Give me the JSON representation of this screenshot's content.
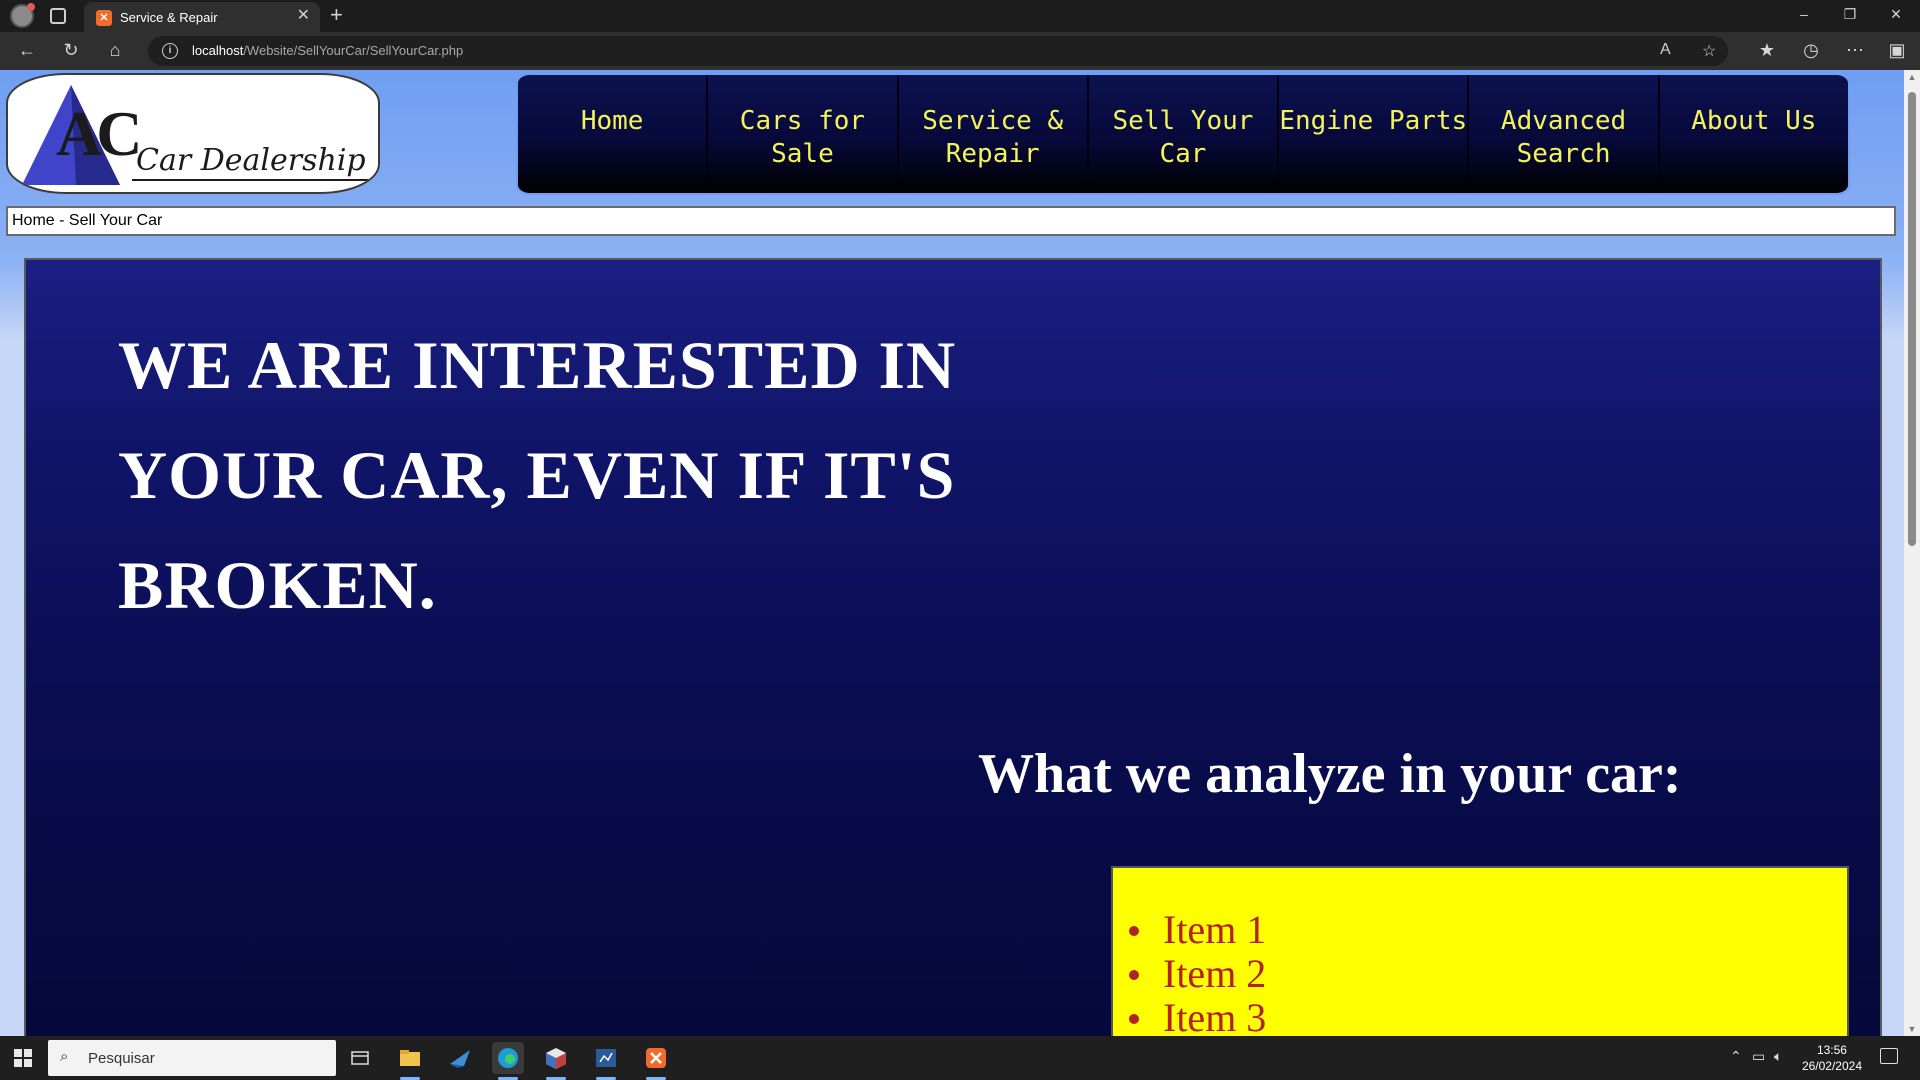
{
  "browser": {
    "tab_title": "Service & Repair",
    "tab_favicon": "xampp-icon",
    "url_host": "localhost",
    "url_path": "/Website/SellYourCar/SellYourCar.php"
  },
  "logo": {
    "mark": "AC",
    "name": "Car Dealership"
  },
  "menu": {
    "items": [
      {
        "label": "Home"
      },
      {
        "label": "Cars for Sale"
      },
      {
        "label": "Service & Repair"
      },
      {
        "label": "Sell Your Car"
      },
      {
        "label": "Engine Parts"
      },
      {
        "label": "Advanced Search"
      },
      {
        "label": "About Us"
      }
    ]
  },
  "breadcrumb": "Home - Sell Your Car",
  "main": {
    "headline_line1": "WE ARE INTERESTED IN",
    "headline_line2": "YOUR CAR, EVEN IF IT'S",
    "headline_line3": "BROKEN.",
    "analyze_heading": "What we analyze in your car:",
    "items": [
      "Item 1",
      "Item 2",
      "Item 3"
    ]
  },
  "taskbar": {
    "search_placeholder": "Pesquisar",
    "time": "13:56",
    "date": "26/02/2024"
  },
  "colors": {
    "menu_text": "#f5f35a",
    "list_box": "#ffff00",
    "list_text": "#b22222"
  }
}
